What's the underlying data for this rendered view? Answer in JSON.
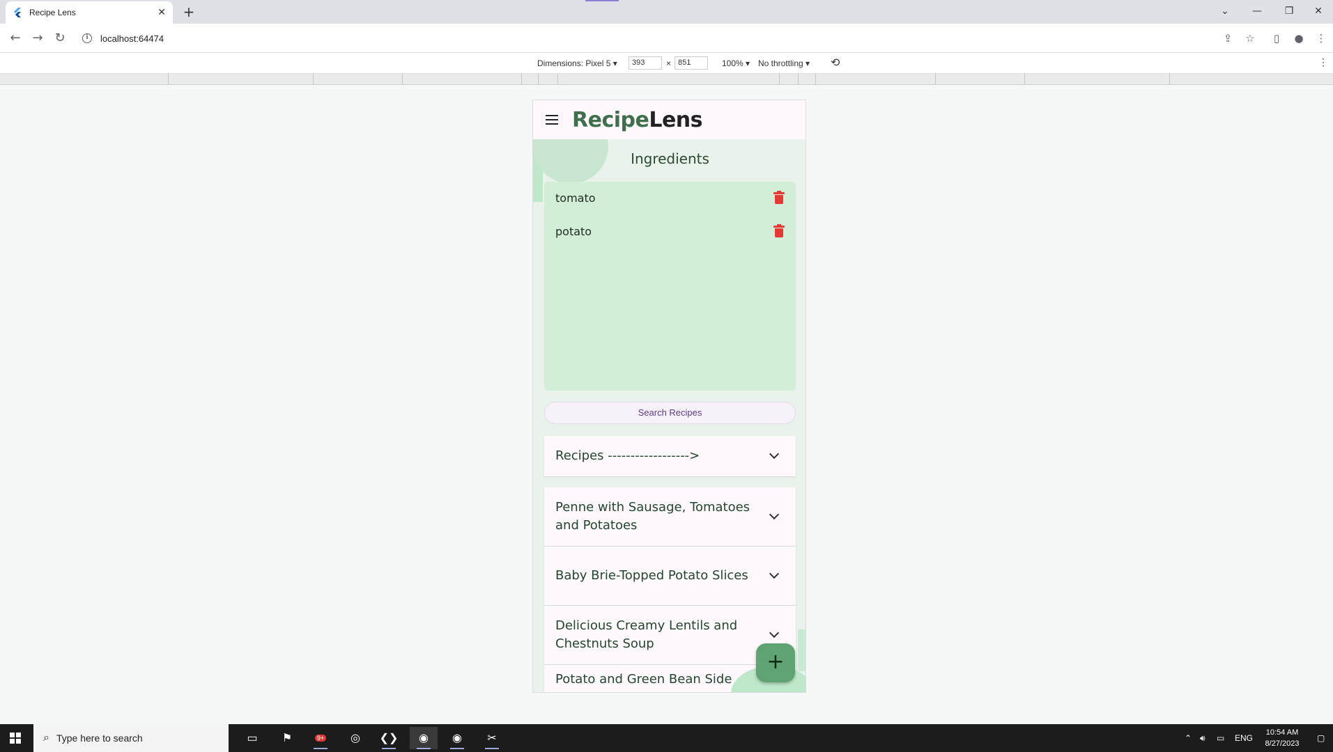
{
  "browser": {
    "tab_title": "Recipe Lens",
    "tab_close": "✕",
    "new_tab": "+",
    "url": "localhost:64474",
    "window_controls": {
      "minimize": "—",
      "restore": "❐",
      "close": "✕",
      "tabs_dropdown": "⌄"
    }
  },
  "devtools": {
    "dimensions_label": "Dimensions: Pixel 5 ▾",
    "width_value": "393",
    "height_value": "851",
    "times": "×",
    "zoom": "100% ▾",
    "throttling": "No throttling ▾"
  },
  "app": {
    "logo_part1": "Recipe",
    "logo_part2": "Lens",
    "section_title": "Ingredients",
    "ingredients": [
      {
        "name": "tomato"
      },
      {
        "name": "potato"
      }
    ],
    "search_button": "Search Recipes",
    "recipes_header": "Recipes ------------------>",
    "recipes": [
      {
        "title": "Penne with Sausage, Tomatoes and Potatoes"
      },
      {
        "title": "Baby Brie-Topped Potato Slices"
      },
      {
        "title": "Delicious Creamy Lentils and Chestnuts Soup"
      },
      {
        "title": "Potato and Green Bean Side"
      }
    ],
    "fab_label": "+",
    "colors": {
      "logo_accent": "#3f6f4b",
      "panel_bg": "#d3eed6",
      "delete_icon": "#e53935",
      "fab_bg": "#5fa372"
    }
  },
  "taskbar": {
    "search_placeholder": "Type here to search",
    "badge": "9+",
    "language": "ENG",
    "time": "10:54 AM",
    "date": "8/27/2023"
  }
}
